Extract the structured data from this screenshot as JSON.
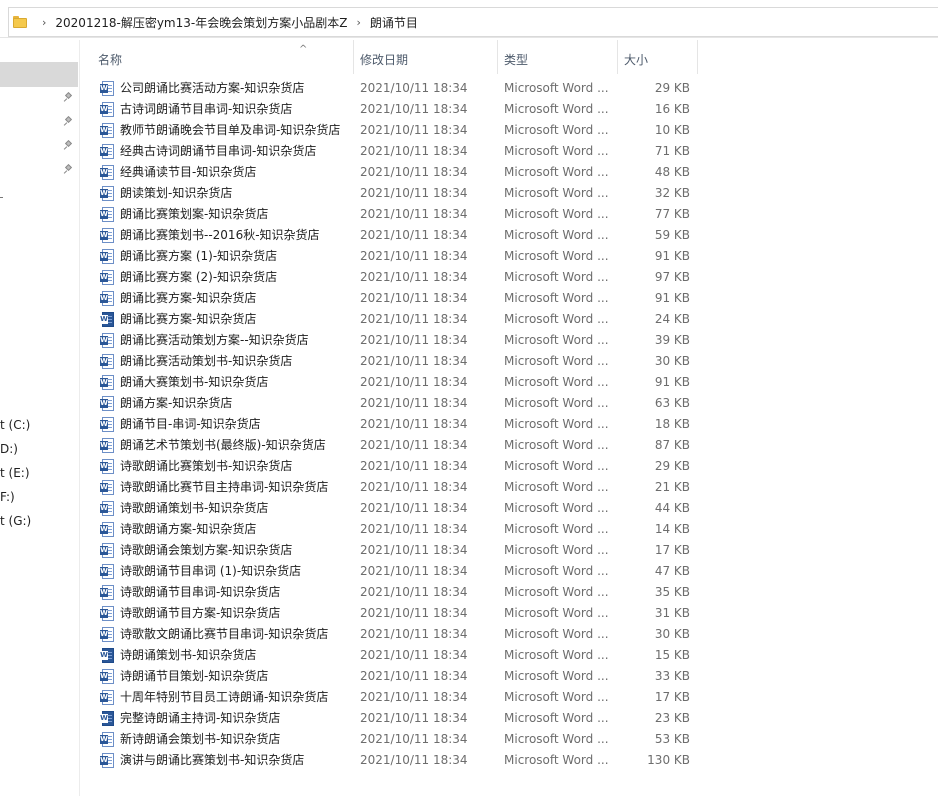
{
  "breadcrumb": {
    "items": [
      "20201218-解压密ym13-年会晚会策划方案小品剧本Z",
      "朗诵节目"
    ]
  },
  "nav": {
    "drives": [
      "t (C:)",
      "D:)",
      "t (E:)",
      "F:)",
      "t (G:)"
    ]
  },
  "columns": {
    "name": "名称",
    "date": "修改日期",
    "type": "类型",
    "size": "大小"
  },
  "icons": {
    "folder": "folder-icon",
    "file": "word-doc-icon",
    "pin": "pin-icon",
    "sort": "sort-ascending-icon"
  },
  "colors": {
    "word_blue": "#2b5797",
    "selected_bg": "#d9d9d9"
  },
  "files": [
    {
      "name": "公司朗诵比赛活动方案-知识杂货店",
      "date": "2021/10/11 18:34",
      "type": "Microsoft Word ...",
      "size": "29 KB"
    },
    {
      "name": "古诗词朗诵节目串词-知识杂货店",
      "date": "2021/10/11 18:34",
      "type": "Microsoft Word ...",
      "size": "16 KB"
    },
    {
      "name": "教师节朗诵晚会节目单及串词-知识杂货店",
      "date": "2021/10/11 18:34",
      "type": "Microsoft Word ...",
      "size": "10 KB"
    },
    {
      "name": "经典古诗词朗诵节目串词-知识杂货店",
      "date": "2021/10/11 18:34",
      "type": "Microsoft Word ...",
      "size": "71 KB"
    },
    {
      "name": "经典诵读节目-知识杂货店",
      "date": "2021/10/11 18:34",
      "type": "Microsoft Word ...",
      "size": "48 KB"
    },
    {
      "name": "朗读策划-知识杂货店",
      "date": "2021/10/11 18:34",
      "type": "Microsoft Word ...",
      "size": "32 KB"
    },
    {
      "name": "朗诵比赛策划案-知识杂货店",
      "date": "2021/10/11 18:34",
      "type": "Microsoft Word ...",
      "size": "77 KB"
    },
    {
      "name": "朗诵比赛策划书--2016秋-知识杂货店",
      "date": "2021/10/11 18:34",
      "type": "Microsoft Word ...",
      "size": "59 KB"
    },
    {
      "name": "朗诵比赛方案 (1)-知识杂货店",
      "date": "2021/10/11 18:34",
      "type": "Microsoft Word ...",
      "size": "91 KB"
    },
    {
      "name": "朗诵比赛方案 (2)-知识杂货店",
      "date": "2021/10/11 18:34",
      "type": "Microsoft Word ...",
      "size": "97 KB"
    },
    {
      "name": "朗诵比赛方案-知识杂货店",
      "date": "2021/10/11 18:34",
      "type": "Microsoft Word ...",
      "size": "91 KB"
    },
    {
      "name": "朗诵比赛方案-知识杂货店",
      "date": "2021/10/11 18:34",
      "type": "Microsoft Word ...",
      "size": "24 KB",
      "alt": true
    },
    {
      "name": "朗诵比赛活动策划方案--知识杂货店",
      "date": "2021/10/11 18:34",
      "type": "Microsoft Word ...",
      "size": "39 KB"
    },
    {
      "name": "朗诵比赛活动策划书-知识杂货店",
      "date": "2021/10/11 18:34",
      "type": "Microsoft Word ...",
      "size": "30 KB"
    },
    {
      "name": "朗诵大赛策划书-知识杂货店",
      "date": "2021/10/11 18:34",
      "type": "Microsoft Word ...",
      "size": "91 KB"
    },
    {
      "name": "朗诵方案-知识杂货店",
      "date": "2021/10/11 18:34",
      "type": "Microsoft Word ...",
      "size": "63 KB"
    },
    {
      "name": "朗诵节目-串词-知识杂货店",
      "date": "2021/10/11 18:34",
      "type": "Microsoft Word ...",
      "size": "18 KB"
    },
    {
      "name": "朗诵艺术节策划书(最终版)-知识杂货店",
      "date": "2021/10/11 18:34",
      "type": "Microsoft Word ...",
      "size": "87 KB"
    },
    {
      "name": "诗歌朗诵比赛策划书-知识杂货店",
      "date": "2021/10/11 18:34",
      "type": "Microsoft Word ...",
      "size": "29 KB"
    },
    {
      "name": "诗歌朗诵比赛节目主持串词-知识杂货店",
      "date": "2021/10/11 18:34",
      "type": "Microsoft Word ...",
      "size": "21 KB"
    },
    {
      "name": "诗歌朗诵策划书-知识杂货店",
      "date": "2021/10/11 18:34",
      "type": "Microsoft Word ...",
      "size": "44 KB"
    },
    {
      "name": "诗歌朗诵方案-知识杂货店",
      "date": "2021/10/11 18:34",
      "type": "Microsoft Word ...",
      "size": "14 KB"
    },
    {
      "name": "诗歌朗诵会策划方案-知识杂货店",
      "date": "2021/10/11 18:34",
      "type": "Microsoft Word ...",
      "size": "17 KB"
    },
    {
      "name": "诗歌朗诵节目串词 (1)-知识杂货店",
      "date": "2021/10/11 18:34",
      "type": "Microsoft Word ...",
      "size": "47 KB"
    },
    {
      "name": "诗歌朗诵节目串词-知识杂货店",
      "date": "2021/10/11 18:34",
      "type": "Microsoft Word ...",
      "size": "35 KB"
    },
    {
      "name": "诗歌朗诵节目方案-知识杂货店",
      "date": "2021/10/11 18:34",
      "type": "Microsoft Word ...",
      "size": "31 KB"
    },
    {
      "name": "诗歌散文朗诵比赛节目串词-知识杂货店",
      "date": "2021/10/11 18:34",
      "type": "Microsoft Word ...",
      "size": "30 KB"
    },
    {
      "name": "诗朗诵策划书-知识杂货店",
      "date": "2021/10/11 18:34",
      "type": "Microsoft Word ...",
      "size": "15 KB",
      "alt": true
    },
    {
      "name": "诗朗诵节目策划-知识杂货店",
      "date": "2021/10/11 18:34",
      "type": "Microsoft Word ...",
      "size": "33 KB"
    },
    {
      "name": "十周年特别节目员工诗朗诵-知识杂货店",
      "date": "2021/10/11 18:34",
      "type": "Microsoft Word ...",
      "size": "17 KB"
    },
    {
      "name": "完整诗朗诵主持词-知识杂货店",
      "date": "2021/10/11 18:34",
      "type": "Microsoft Word ...",
      "size": "23 KB",
      "alt": true
    },
    {
      "name": "新诗朗诵会策划书-知识杂货店",
      "date": "2021/10/11 18:34",
      "type": "Microsoft Word ...",
      "size": "53 KB"
    },
    {
      "name": "演讲与朗诵比赛策划书-知识杂货店",
      "date": "2021/10/11 18:34",
      "type": "Microsoft Word ...",
      "size": "130 KB"
    }
  ]
}
